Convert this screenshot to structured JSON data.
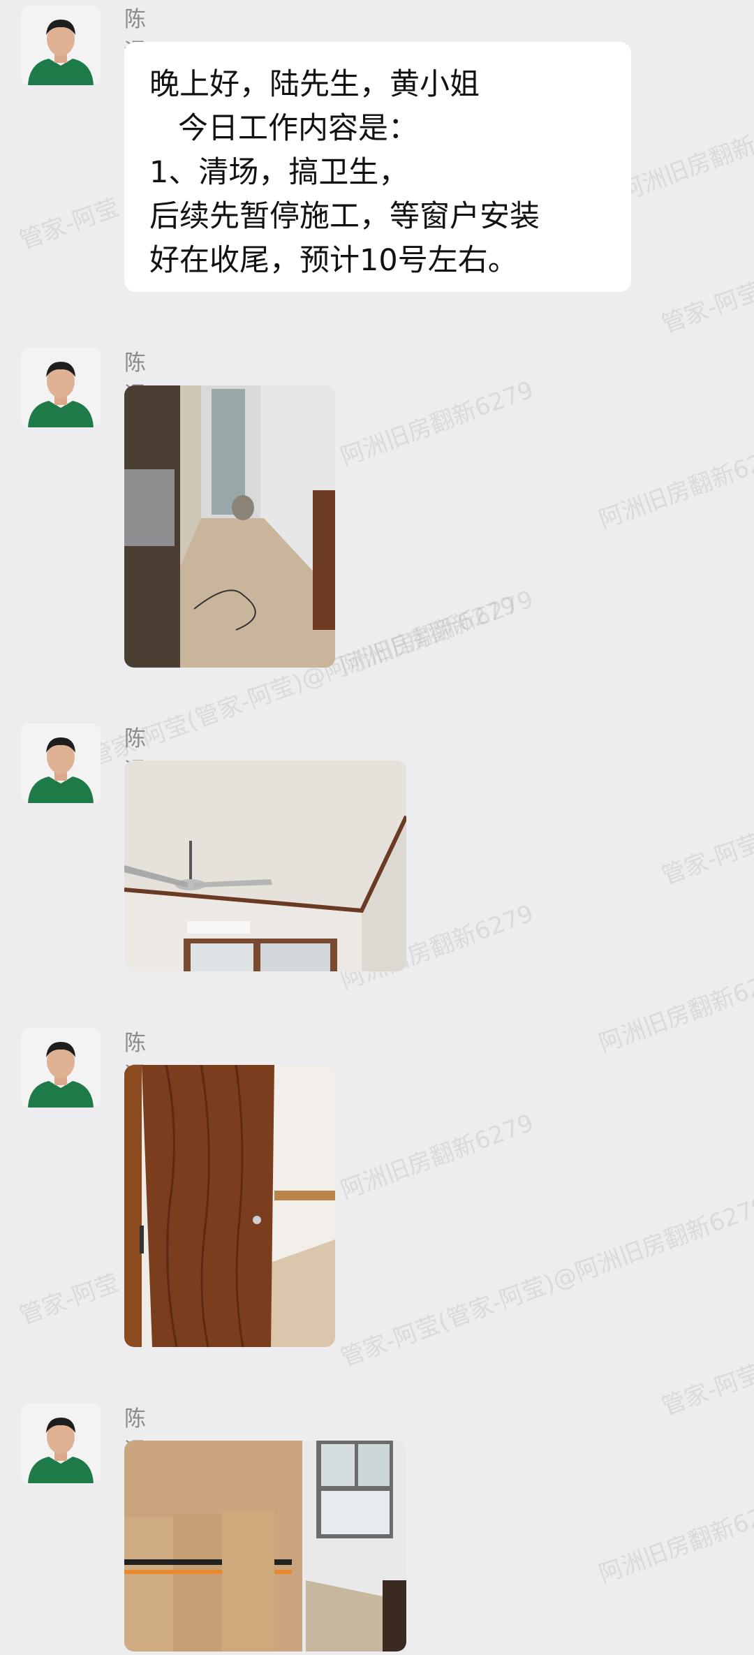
{
  "watermark": {
    "items": [
      "管家-阿莹",
      "阿洲旧房翻新6279",
      "管家-阿莹(管家-阿莹)@阿洲旧房翻新6279"
    ]
  },
  "messages": [
    {
      "sender": "陈运忠",
      "type": "text",
      "lines": [
        "晚上好，陆先生，黄小姐",
        "   今日工作内容是：",
        "1、清场，搞卫生，",
        "后续先暂停施工，等窗户安装",
        "好在收尾，预计10号左右。"
      ]
    },
    {
      "sender": "陈运忠",
      "type": "image",
      "icon": "room-floor-photo"
    },
    {
      "sender": "陈运忠",
      "type": "image",
      "icon": "ceiling-fan-photo"
    },
    {
      "sender": "陈运忠",
      "type": "image",
      "icon": "wooden-door-photo"
    },
    {
      "sender": "陈运忠",
      "type": "image",
      "icon": "window-cabinet-photo"
    }
  ]
}
